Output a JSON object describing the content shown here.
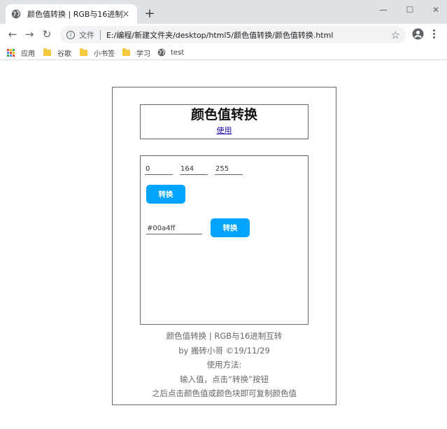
{
  "browser": {
    "tab_title": "颜色值转换 | RGB与16进制互转",
    "tab_close": "×",
    "new_tab": "+",
    "window_minimize": "—",
    "window_maximize": "☐",
    "window_close": "✕",
    "back": "←",
    "forward": "→",
    "reload": "↻",
    "scheme_label": "文件",
    "url": "E:/编程/新建文件夹/desktop/html5/颜色值转换/颜色值转换.html",
    "star": "☆",
    "bookmarks": [
      "应用",
      "谷歌",
      "小书签",
      "学习",
      "test"
    ]
  },
  "page": {
    "title": "颜色值转换",
    "usage_link": "使用",
    "rgb": {
      "r": "0",
      "g": "164",
      "b": "255"
    },
    "convert_to_hex_label": "转换",
    "hex_value": "#00a4ff",
    "convert_to_rgb_label": "转换",
    "footer": [
      "颜色值转换 | RGB与16进制互转",
      "by 搬砖小哥 ©19/11/29",
      "使用方法:",
      "输入值，点击“转换”按钮",
      "之后点击颜色值或颜色块即可复制颜色值"
    ]
  },
  "colors": {
    "accent": "#00a4ff",
    "chrome_bg": "#dee1e6",
    "omnibox_bg": "#f1f3f4",
    "folder": "#f5c842",
    "link": "#1a0dab"
  }
}
